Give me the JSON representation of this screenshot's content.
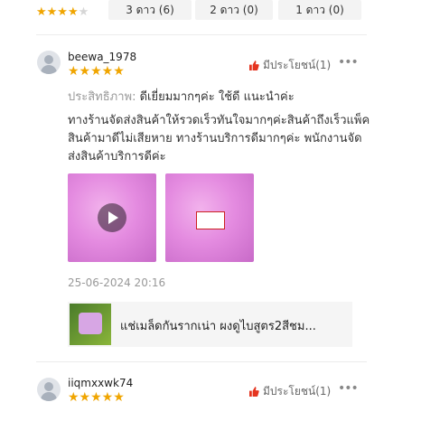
{
  "top_bar": {
    "stars_rating": 4,
    "filters": [
      {
        "label": "3 ดาว (6)"
      },
      {
        "label": "2 ดาว (0)"
      },
      {
        "label": "1 ดาว (0)"
      }
    ]
  },
  "reviews": [
    {
      "username": "beewa_1978",
      "rating": 5,
      "helpful_label": "มีประโยชน์(1)",
      "performance_label": "ประสิทธิภาพ:",
      "performance_value": " ดีเยี่ยมมากๆค่ะ ใช้ดี แนะนำค่ะ",
      "body": "ทางร้านจัดส่งสินค้าให้รวดเร็วทันใจมากๆค่ะสินค้าถึงเร็วแพ็คสินค้ามาดีไม่เสียหาย ทางร้านบริการดีมากๆค่ะ พนักงานจัดส่งสินค้าบริการดีค่ะ",
      "date": "25-06-2024 20:16",
      "product_name": "แช่เมล็ดกันรากเน่า ผงดูไบสูตร2สีชม..."
    },
    {
      "username": "iiqmxxwk74",
      "rating": 5,
      "helpful_label": "มีประโยชน์(1)"
    }
  ],
  "colors": {
    "star": "#f0a500",
    "helpful_thumb": "#e5341f",
    "accent_pink": "#e48be0"
  }
}
